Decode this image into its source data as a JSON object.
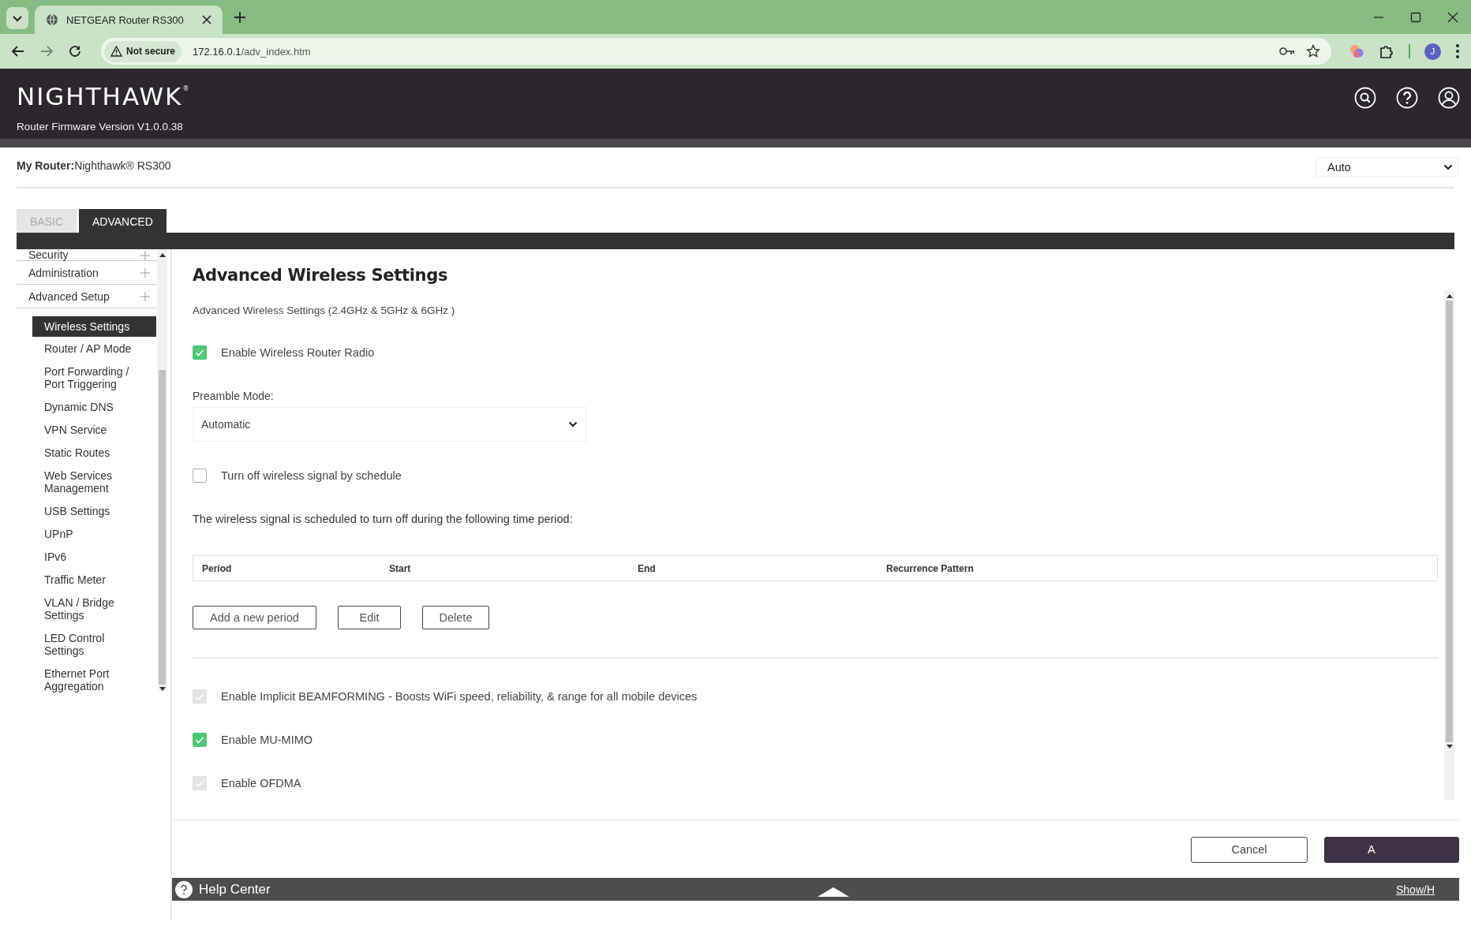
{
  "browser": {
    "tab_title": "NETGEAR Router RS300",
    "security_label": "Not secure",
    "url_host": "172.16.0.1",
    "url_path": "/adv_index.htm",
    "profile_initial": "J"
  },
  "header": {
    "logo": "NIGHTHAWK$^{®}$",
    "firmware": "Router Firmware Version V1.0.0.38"
  },
  "router_bar": {
    "label": "My Router:",
    "value": "Nighthawk® RS300",
    "language": "Auto"
  },
  "tabs": [
    {
      "label": "BASIC",
      "selected": false
    },
    {
      "label": "ADVANCED",
      "selected": true
    }
  ],
  "sidebar": {
    "sections": [
      {
        "label": "Security"
      },
      {
        "label": "Administration"
      },
      {
        "label": "Advanced Setup",
        "children": [
          {
            "label": "Wireless Settings",
            "selected": true
          },
          {
            "label": "Router / AP Mode",
            "selected": false
          },
          {
            "label": "Port Forwarding / Port Triggering",
            "selected": false
          },
          {
            "label": "Dynamic DNS",
            "selected": false
          },
          {
            "label": "VPN Service",
            "selected": false
          },
          {
            "label": "Static Routes",
            "selected": false
          },
          {
            "label": "Web Services Management",
            "selected": false
          },
          {
            "label": "USB Settings",
            "selected": false
          },
          {
            "label": "UPnP",
            "selected": false
          },
          {
            "label": "IPv6",
            "selected": false
          },
          {
            "label": "Traffic Meter",
            "selected": false
          },
          {
            "label": "VLAN / Bridge Settings",
            "selected": false
          },
          {
            "label": "LED Control Settings",
            "selected": false
          },
          {
            "label": "Ethernet Port Aggregation",
            "selected": false
          }
        ]
      }
    ]
  },
  "content": {
    "title": "Advanced Wireless Settings",
    "settings": [
      {
        "kind": "subtitle",
        "text": "Advanced Wireless Settings (2.4GHz & 5GHz & 6GHz )"
      },
      {
        "kind": "checkbox",
        "label": "Enable Wireless Router Radio",
        "checked": true,
        "disabled": false
      },
      {
        "kind": "select",
        "label": "Preamble Mode:",
        "value": "Automatic"
      },
      {
        "kind": "checkbox",
        "label": "Turn off wireless signal by schedule",
        "checked": false,
        "disabled": false
      },
      {
        "kind": "note",
        "text": "The wireless signal is scheduled to turn off during the following time period:"
      },
      {
        "kind": "table",
        "columns": [
          "Period",
          "Start",
          "End",
          "Recurrence Pattern"
        ]
      },
      {
        "kind": "buttons",
        "buttons": [
          "Add a new period",
          "Edit",
          "Delete"
        ]
      },
      {
        "kind": "divider"
      },
      {
        "kind": "checkbox",
        "label": "Enable Implicit BEAMFORMING - Boosts WiFi speed, reliability, & range for all mobile devices",
        "checked": true,
        "disabled": true
      },
      {
        "kind": "checkbox",
        "label": "Enable MU-MIMO",
        "checked": true,
        "disabled": false
      },
      {
        "kind": "checkbox",
        "label": "Enable OFDMA",
        "checked": true,
        "disabled": true
      }
    ]
  },
  "actions": [
    {
      "label": "Cancel",
      "kind": "secondary"
    },
    {
      "label": "A",
      "kind": "primary"
    }
  ],
  "help_bar": {
    "title": "Help Center",
    "toggle": "Show/H"
  }
}
